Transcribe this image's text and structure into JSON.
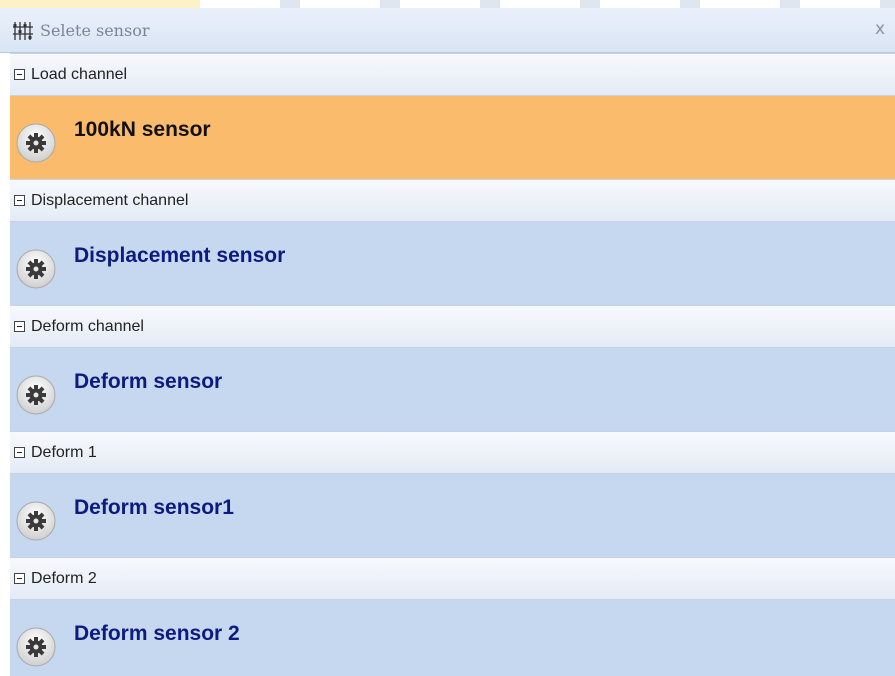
{
  "window": {
    "title": "Selete sensor",
    "close_label": "x",
    "app_icon": "sensor-grid-icon"
  },
  "groups": [
    {
      "header": "Load channel",
      "sensor": "100kN sensor",
      "selected": true
    },
    {
      "header": "Displacement channel",
      "sensor": "Displacement sensor",
      "selected": false
    },
    {
      "header": "Deform channel",
      "sensor": "Deform sensor",
      "selected": false
    },
    {
      "header": "Deform 1",
      "sensor": "Deform sensor1",
      "selected": false
    },
    {
      "header": "Deform 2",
      "sensor": "Deform sensor 2",
      "selected": false
    }
  ],
  "icons": {
    "group_toggle": "collapse-box-icon",
    "sensor": "gear-icon"
  },
  "colors": {
    "selected_bg": "#fbbb6c",
    "item_bg": "#c5d8ef",
    "item_text": "#0d1a80",
    "selected_text": "#111111"
  }
}
